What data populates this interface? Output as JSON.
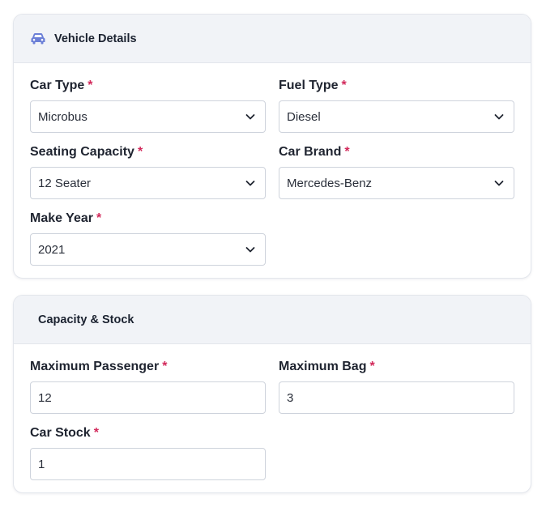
{
  "vehicle_details": {
    "title": "Vehicle Details",
    "header_icon": "car-icon",
    "accent_color": "#6b7fd7",
    "fields": {
      "car_type": {
        "label": "Car Type",
        "required": "*",
        "value": "Microbus"
      },
      "fuel_type": {
        "label": "Fuel Type",
        "required": "*",
        "value": "Diesel"
      },
      "seating_capacity": {
        "label": "Seating Capacity",
        "required": "*",
        "value": "12 Seater"
      },
      "car_brand": {
        "label": "Car Brand",
        "required": "*",
        "value": "Mercedes-Benz"
      },
      "make_year": {
        "label": "Make Year",
        "required": "*",
        "value": "2021"
      }
    }
  },
  "capacity_stock": {
    "title": "Capacity & Stock",
    "fields": {
      "maximum_passenger": {
        "label": "Maximum Passenger",
        "required": "*",
        "value": "12"
      },
      "maximum_bag": {
        "label": "Maximum Bag",
        "required": "*",
        "value": "3"
      },
      "car_stock": {
        "label": "Car Stock",
        "required": "*",
        "value": "1"
      }
    }
  },
  "required_color": "#d2285a"
}
